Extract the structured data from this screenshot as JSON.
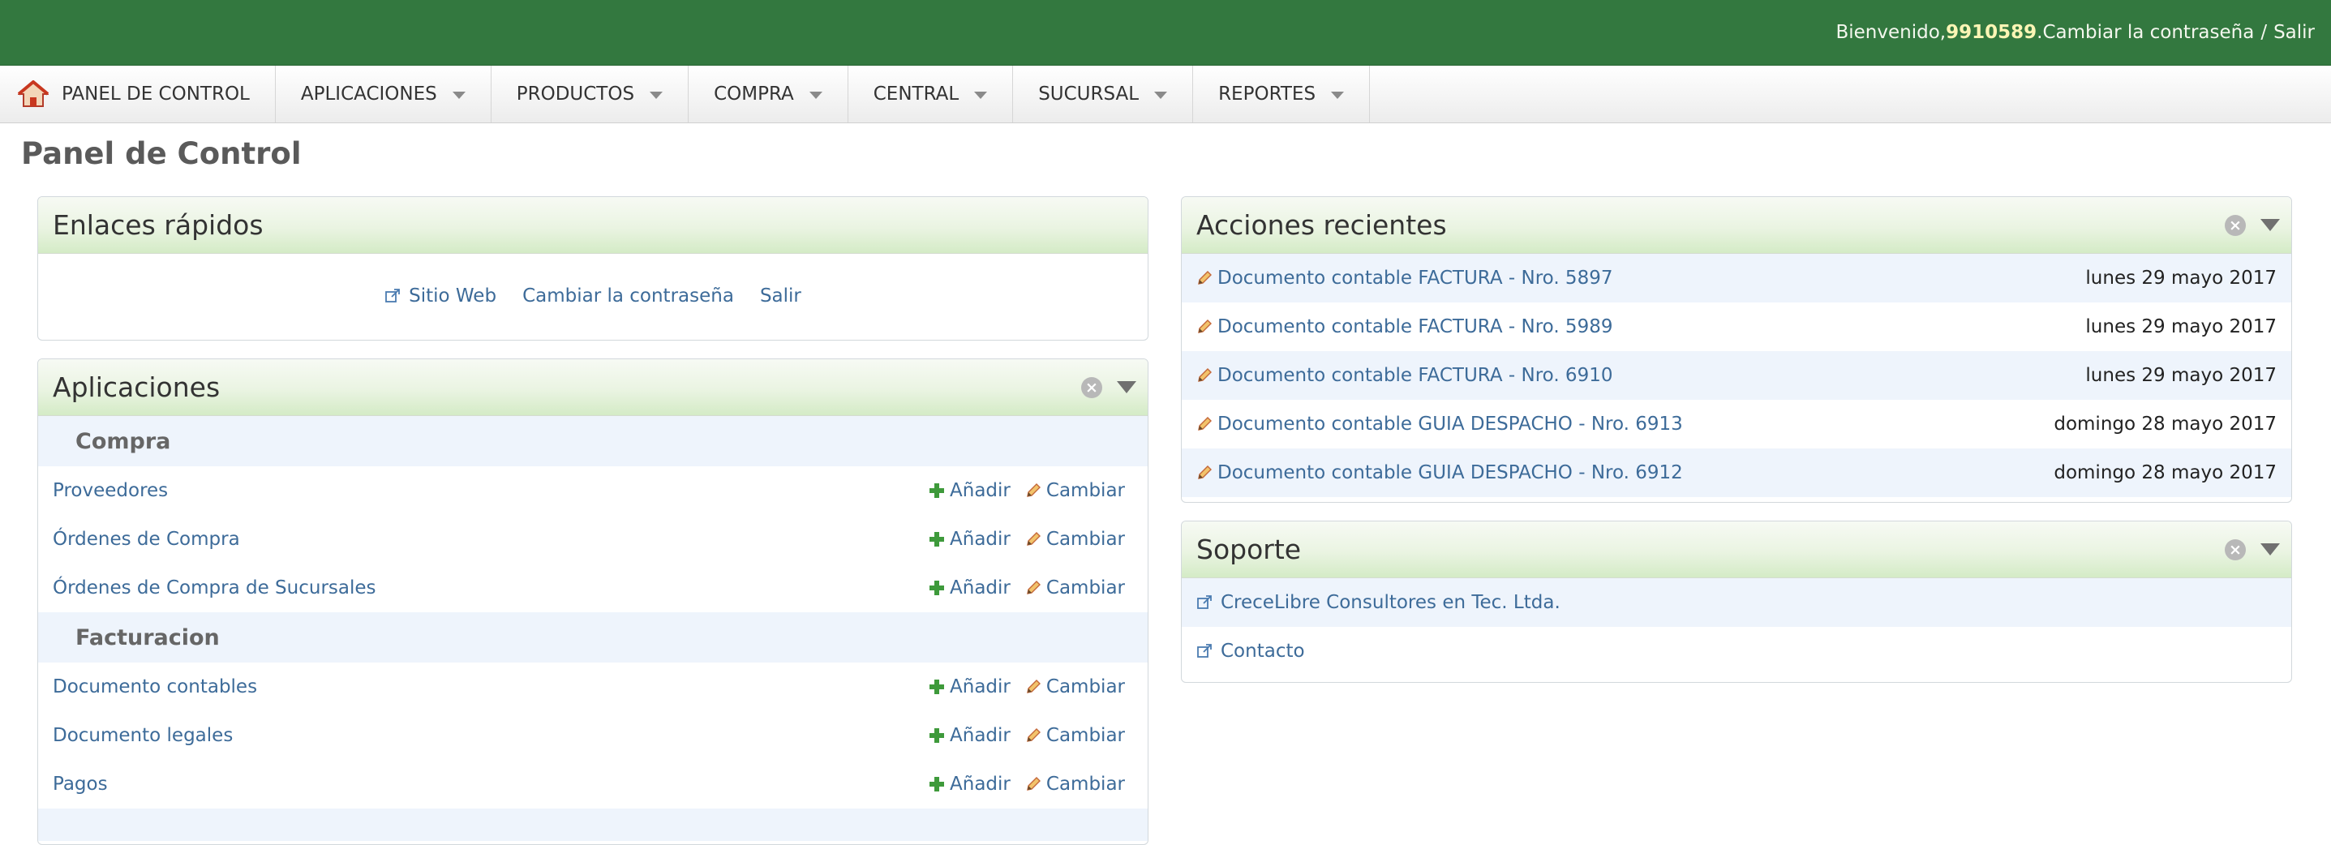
{
  "header": {
    "welcome_prefix": "Bienvenido, ",
    "username": "9910589",
    "welcome_suffix": ". ",
    "change_password": "Cambiar la contraseña",
    "separator": "/",
    "logout": "Salir",
    "bg_color": "#33783f"
  },
  "nav": {
    "home_label": "PANEL DE CONTROL",
    "items": [
      {
        "label": "APLICACIONES"
      },
      {
        "label": "PRODUCTOS"
      },
      {
        "label": "COMPRA"
      },
      {
        "label": "CENTRAL"
      },
      {
        "label": "SUCURSAL"
      },
      {
        "label": "REPORTES"
      }
    ]
  },
  "page_title": "Panel de Control",
  "quick_links": {
    "title": "Enlaces rápidos",
    "website": "Sitio Web",
    "change_password": "Cambiar la contraseña",
    "logout": "Salir"
  },
  "apps": {
    "title": "Aplicaciones",
    "add_label": "Añadir",
    "change_label": "Cambiar",
    "sections": [
      {
        "name": "Compra",
        "items": [
          "Proveedores",
          "Órdenes de Compra",
          "Órdenes de Compra de Sucursales"
        ]
      },
      {
        "name": "Facturacion",
        "items": [
          "Documento contables",
          "Documento legales",
          "Pagos"
        ]
      }
    ]
  },
  "recent": {
    "title": "Acciones recientes",
    "items": [
      {
        "text": "Documento contable FACTURA - Nro. 5897",
        "date": "lunes 29 mayo 2017"
      },
      {
        "text": "Documento contable FACTURA - Nro. 5989",
        "date": "lunes 29 mayo 2017"
      },
      {
        "text": "Documento contable FACTURA - Nro. 6910",
        "date": "lunes 29 mayo 2017"
      },
      {
        "text": "Documento contable GUIA DESPACHO - Nro. 6913",
        "date": "domingo 28 mayo 2017"
      },
      {
        "text": "Documento contable GUIA DESPACHO - Nro. 6912",
        "date": "domingo 28 mayo 2017"
      }
    ]
  },
  "support": {
    "title": "Soporte",
    "items": [
      "CreceLibre Consultores en Tec. Ltda.",
      "Contacto"
    ]
  },
  "icons": {
    "home": "home-icon",
    "close": "close-icon",
    "collapse": "collapse-icon",
    "add": "plus-icon",
    "edit": "pencil-icon",
    "external": "external-link-icon"
  },
  "colors": {
    "link": "#3d6b99",
    "alt_row": "#eef4fc",
    "header_green": "#33783f",
    "add_green": "#3e9a3b"
  }
}
